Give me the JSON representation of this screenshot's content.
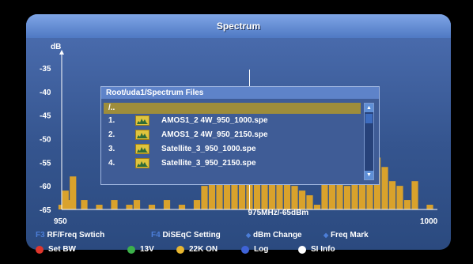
{
  "window": {
    "title": "Spectrum"
  },
  "chart_data": {
    "type": "area",
    "ylabel": "dB",
    "y_ticks": [
      "-35",
      "-40",
      "-45",
      "-50",
      "-55",
      "-60",
      "-65"
    ],
    "ylim": [
      -65,
      -33
    ],
    "xlim": [
      950,
      1000
    ],
    "x_tick_labels": [
      "950",
      "1000"
    ],
    "marker": {
      "x": 975,
      "readout": "975MHz/-65dBm"
    },
    "series": [
      {
        "color": "#d9a22c",
        "x": [
          950,
          950.5,
          951,
          951.5,
          952,
          953,
          954,
          955,
          956,
          957,
          958,
          959,
          960,
          961,
          962,
          963,
          964,
          965,
          966,
          967,
          968,
          969,
          970,
          971,
          972,
          973,
          974,
          975,
          976,
          977,
          978,
          979,
          980,
          981,
          982,
          983,
          984,
          985,
          986,
          987,
          988,
          989,
          990,
          991,
          992,
          993,
          994,
          995,
          996,
          997,
          998,
          999,
          1000
        ],
        "y": [
          -64,
          -61,
          -63,
          -58,
          -65,
          -63,
          -65,
          -64,
          -65,
          -63,
          -65,
          -64,
          -63,
          -65,
          -64,
          -65,
          -63,
          -65,
          -64,
          -65,
          -63,
          -60,
          -58,
          -57,
          -56,
          -57,
          -58,
          -59,
          -58,
          -57,
          -56,
          -58,
          -59,
          -60,
          -61,
          -62,
          -64,
          -58,
          -56,
          -58,
          -60,
          -57,
          -55,
          -53,
          -54,
          -56,
          -59,
          -60,
          -63,
          -59,
          -65,
          -64,
          -65
        ]
      }
    ]
  },
  "dialog": {
    "title": "Root/uda1/Spectrum Files",
    "parent": "/..",
    "files": [
      {
        "num": "1.",
        "name": "AMOS1_2 4W_950_1000.spe"
      },
      {
        "num": "2.",
        "name": "AMOS1_2 4W_950_2150.spe"
      },
      {
        "num": "3.",
        "name": "Satellite_3_950_1000.spe"
      },
      {
        "num": "4.",
        "name": "Satellite_3_950_2150.spe"
      }
    ],
    "file_icon": "spectrum-file-icon"
  },
  "hints": {
    "f3_key": "F3",
    "f3_label": "RF/Freq Swtich",
    "f4_key": "F4",
    "f4_label": "DiSEqC Setting",
    "updown_label": "dBm Change",
    "leftright_label": "Freq Mark"
  },
  "buttons": [
    {
      "label": "Set BW",
      "color": "#e0362c"
    },
    {
      "label": "13V",
      "color": "#3cb04a"
    },
    {
      "label": "22K ON",
      "color": "#e8b630"
    },
    {
      "label": "Log",
      "color": "#3f63d8"
    },
    {
      "label": "SI Info",
      "color": "#ffffff"
    }
  ]
}
